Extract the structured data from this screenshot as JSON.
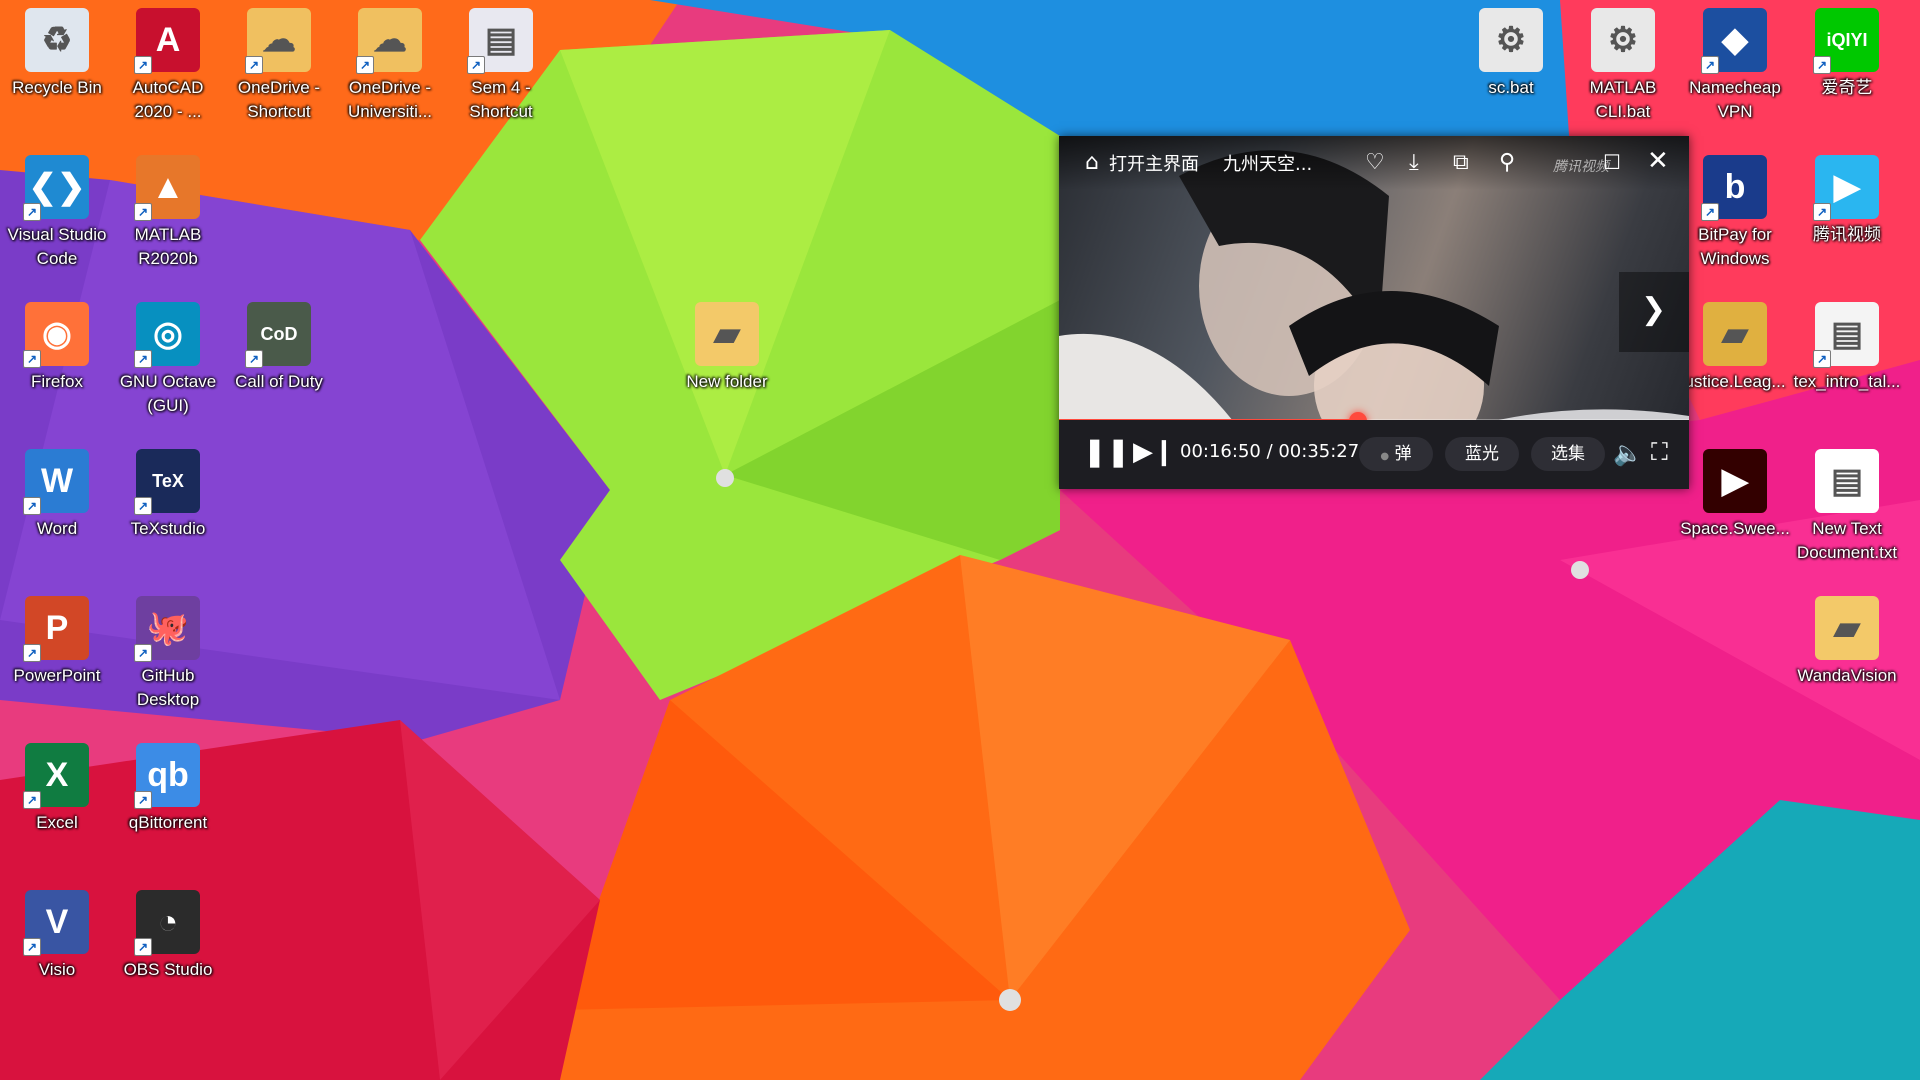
{
  "desktop": {
    "icons": [
      {
        "id": "recycle-bin",
        "label": "Recycle Bin",
        "glyph": "♻",
        "color": "#dfe6ee",
        "icon": "recycle-bin-icon",
        "shortcut": false
      },
      {
        "id": "autocad",
        "label": "AutoCAD 2020 - ...",
        "glyph": "A",
        "color": "#c8102e",
        "icon": "autocad-icon",
        "shortcut": true
      },
      {
        "id": "onedrive-shortcut",
        "label": "OneDrive - Shortcut",
        "glyph": "☁",
        "color": "#f0c060",
        "icon": "onedrive-folder-icon",
        "shortcut": true
      },
      {
        "id": "onedrive-university",
        "label": "OneDrive - Universiti...",
        "glyph": "☁",
        "color": "#f0c060",
        "icon": "onedrive-folder-icon",
        "shortcut": true
      },
      {
        "id": "sem4",
        "label": "Sem 4 - Shortcut",
        "glyph": "▤",
        "color": "#e8e8f0",
        "icon": "pdf-document-icon",
        "shortcut": true
      },
      {
        "id": "vscode",
        "label": "Visual Studio Code",
        "glyph": "❮❯",
        "color": "#1f8ad2",
        "icon": "vscode-icon",
        "shortcut": true
      },
      {
        "id": "matlab",
        "label": "MATLAB R2020b",
        "glyph": "▲",
        "color": "#e7772a",
        "icon": "matlab-icon",
        "shortcut": true
      },
      {
        "id": "firefox",
        "label": "Firefox",
        "glyph": "◉",
        "color": "#ff7139",
        "icon": "firefox-icon",
        "shortcut": true
      },
      {
        "id": "octave",
        "label": "GNU Octave (GUI)",
        "glyph": "◎",
        "color": "#0790c0",
        "icon": "octave-icon",
        "shortcut": true
      },
      {
        "id": "cod",
        "label": "Call of Duty",
        "glyph": "CoD",
        "color": "#4a5a4a",
        "icon": "call-of-duty-icon",
        "shortcut": true
      },
      {
        "id": "word",
        "label": "Word",
        "glyph": "W",
        "color": "#2b7cd3",
        "icon": "word-icon",
        "shortcut": true
      },
      {
        "id": "texstudio",
        "label": "TeXstudio",
        "glyph": "TeX",
        "color": "#1a2a5a",
        "icon": "texstudio-icon",
        "shortcut": true
      },
      {
        "id": "powerpoint",
        "label": "PowerPoint",
        "glyph": "P",
        "color": "#d24726",
        "icon": "powerpoint-icon",
        "shortcut": true
      },
      {
        "id": "github",
        "label": "GitHub Desktop",
        "glyph": "🐙",
        "color": "#6e3fa0",
        "icon": "github-icon",
        "shortcut": true
      },
      {
        "id": "excel",
        "label": "Excel",
        "glyph": "X",
        "color": "#107c41",
        "icon": "excel-icon",
        "shortcut": true
      },
      {
        "id": "qbittorrent",
        "label": "qBittorrent",
        "glyph": "qb",
        "color": "#3c8ce6",
        "icon": "qbittorrent-icon",
        "shortcut": true
      },
      {
        "id": "visio",
        "label": "Visio",
        "glyph": "V",
        "color": "#3955a3",
        "icon": "visio-icon",
        "shortcut": true
      },
      {
        "id": "obs",
        "label": "OBS Studio",
        "glyph": "◔",
        "color": "#2b2b2b",
        "icon": "obs-icon",
        "shortcut": true
      },
      {
        "id": "new-folder",
        "label": "New folder",
        "glyph": "▰",
        "color": "#f3c969",
        "icon": "folder-icon",
        "shortcut": false
      },
      {
        "id": "sc-bat",
        "label": "sc.bat",
        "glyph": "⚙",
        "color": "#e8e8e8",
        "icon": "batch-file-icon",
        "shortcut": false
      },
      {
        "id": "matlab-cli",
        "label": "MATLAB CLI.bat",
        "glyph": "⚙",
        "color": "#e8e8e8",
        "icon": "batch-file-icon",
        "shortcut": false
      },
      {
        "id": "namecheap",
        "label": "Namecheap VPN",
        "glyph": "◆",
        "color": "#1c4fa0",
        "icon": "namecheap-vpn-icon",
        "shortcut": true
      },
      {
        "id": "iqiyi",
        "label": "爱奇艺",
        "glyph": "iQIYI",
        "color": "#00c800",
        "icon": "iqiyi-icon",
        "shortcut": true
      },
      {
        "id": "bitpay",
        "label": "BitPay for Windows",
        "glyph": "b",
        "color": "#1a3b8b",
        "icon": "bitpay-icon",
        "shortcut": true
      },
      {
        "id": "tencent-video",
        "label": "腾讯视频",
        "glyph": "▶",
        "color": "#2ab6f0",
        "icon": "tencent-video-icon",
        "shortcut": true
      },
      {
        "id": "justice-league",
        "label": "ustice.Leag...",
        "glyph": "▰",
        "color": "#e0b040",
        "icon": "video-folder-icon",
        "shortcut": false
      },
      {
        "id": "tex-intro",
        "label": "tex_intro_tal...",
        "glyph": "▤",
        "color": "#f4f4f4",
        "icon": "pdf-document-icon",
        "shortcut": true
      },
      {
        "id": "space-sweepers",
        "label": "Space.Swee...",
        "glyph": "▶",
        "color": "#300",
        "icon": "vlc-video-icon",
        "shortcut": false
      },
      {
        "id": "new-text",
        "label": "New Text Document.txt",
        "glyph": "▤",
        "color": "#ffffff",
        "icon": "text-file-icon",
        "shortcut": false
      },
      {
        "id": "wandavision",
        "label": "WandaVision",
        "glyph": "▰",
        "color": "#f3c969",
        "icon": "folder-icon",
        "shortcut": false
      }
    ]
  },
  "player": {
    "open_main_label": "打开主界面",
    "video_title": "九州天空...",
    "watermark": "腾讯视频",
    "current_time": "00:16:50",
    "separator": " / ",
    "total_time": "00:35:27",
    "progress": 0.475,
    "danmaku_label": "弹",
    "quality_label": "蓝光",
    "episodes_label": "选集",
    "accent_color": "#ff4a3d"
  }
}
